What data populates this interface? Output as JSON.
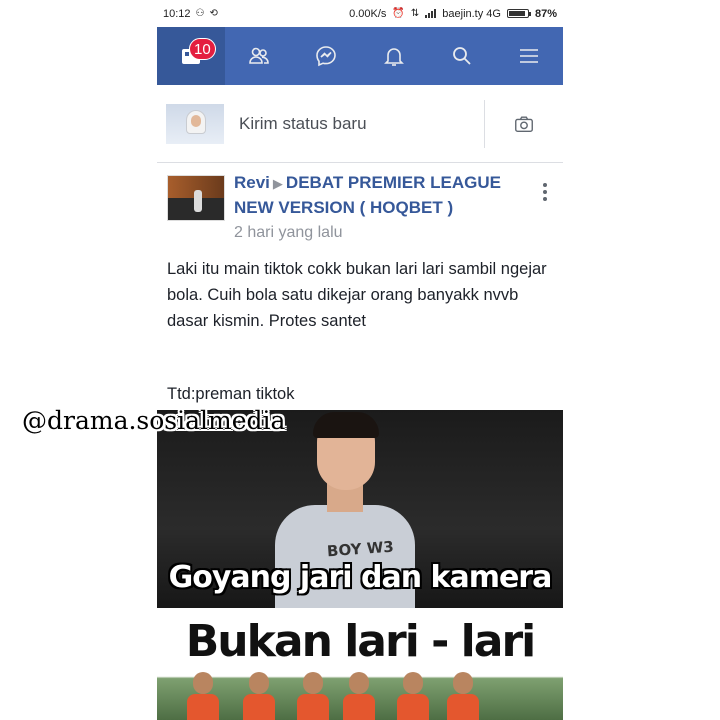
{
  "status_bar": {
    "time": "10:12",
    "speed": "0.00K/s",
    "carrier": "baejin.ty 4G",
    "battery": "87%",
    "battery_level": 0.87
  },
  "nav": {
    "items": [
      {
        "name": "news-feed",
        "icon": "feed-icon",
        "badge": "10"
      },
      {
        "name": "friends",
        "icon": "friends-icon"
      },
      {
        "name": "messenger",
        "icon": "messenger-icon"
      },
      {
        "name": "notifications",
        "icon": "bell-icon"
      },
      {
        "name": "search",
        "icon": "search-icon"
      },
      {
        "name": "menu",
        "icon": "hamburger-icon"
      }
    ],
    "color": "#4267b2"
  },
  "composer": {
    "placeholder": "Kirim status baru",
    "camera_icon": "camera-icon"
  },
  "post": {
    "author": "Revi",
    "group": "DEBAT PREMIER LEAGUE NEW VERSION ( HOQBET )",
    "time": "2 hari yang lalu",
    "text": "Laki itu main tiktok cokk bukan lari lari sambil ngejar bola. Cuih bola satu dikejar orang banyakk nvvb dasar kismin. Protes santet",
    "signature": "Ttd:preman tiktok",
    "image": {
      "caption_top": "Goyang jari dan kamera",
      "shirt_text": "BOY W3",
      "caption_bottom": "Bukan lari - lari"
    }
  },
  "watermark": "@drama.sosialmedia"
}
